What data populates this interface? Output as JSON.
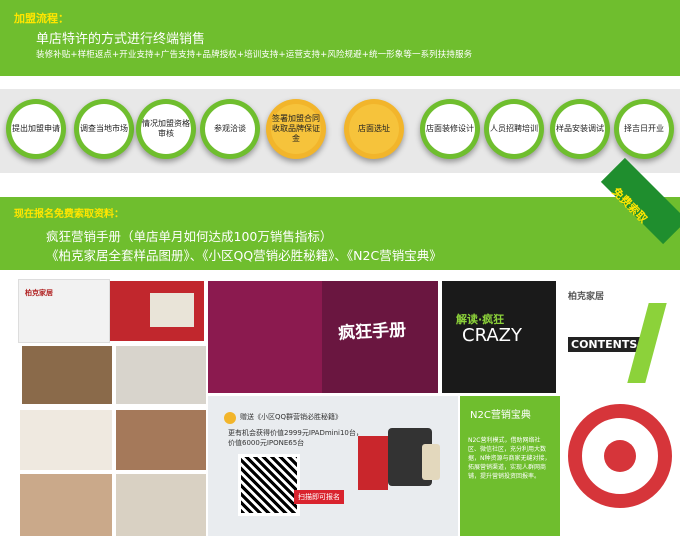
{
  "header": {
    "title": "加盟流程：",
    "headline": "单店特许的方式进行终端销售",
    "subline": "装修补贴+样柜返点+开业支持+广告支持+品牌授权+培训支持+运营支持+风险规避+统一形象等一系列扶持服务"
  },
  "steps": [
    {
      "label": "提出加盟申请"
    },
    {
      "label": "调查当地市场"
    },
    {
      "label": "情况加盟资格审核"
    },
    {
      "label": "参观洽谈"
    },
    {
      "label": "签署加盟合同收取品牌保证金"
    },
    {
      "label": "店面选址"
    },
    {
      "label": "店面装修设计"
    },
    {
      "label": "人员招聘培训"
    },
    {
      "label": "样品安装调试"
    },
    {
      "label": "择吉日开业"
    }
  ],
  "materials": {
    "title": "现在报名免费索取资料：",
    "line1": "疯狂营销手册（单店单月如何达成100万销售指标）",
    "line2": "《柏克家居全套样品图册》、《小区QQ营销必胜秘籍》、《N2C营销宝典》",
    "badge": "免费索取"
  },
  "collage": {
    "brand_small": "柏克家居",
    "book_title": "疯狂手册",
    "crazy_top": "解读·疯狂",
    "crazy_word": "CRAZY",
    "brand_logo": "柏克家居",
    "contents_word": "CONTENTS",
    "qq_gift": "赠送《小区QQ群营销必胜秘籍》",
    "qq_line1": "更有机会获得价值2999元IPADmini10台，",
    "qq_line2": "价值6000元IPONE65台",
    "qq_button": "扫描即可报名",
    "n2c_title": "N2C营销宝典",
    "n2c_text": "N2C营利模式，借助网络社区、微信社区，充分利用大数据，N种资源与商家无缝对接，拓展营销渠道，实现人群网商铺，提升营销投资回报率。"
  }
}
